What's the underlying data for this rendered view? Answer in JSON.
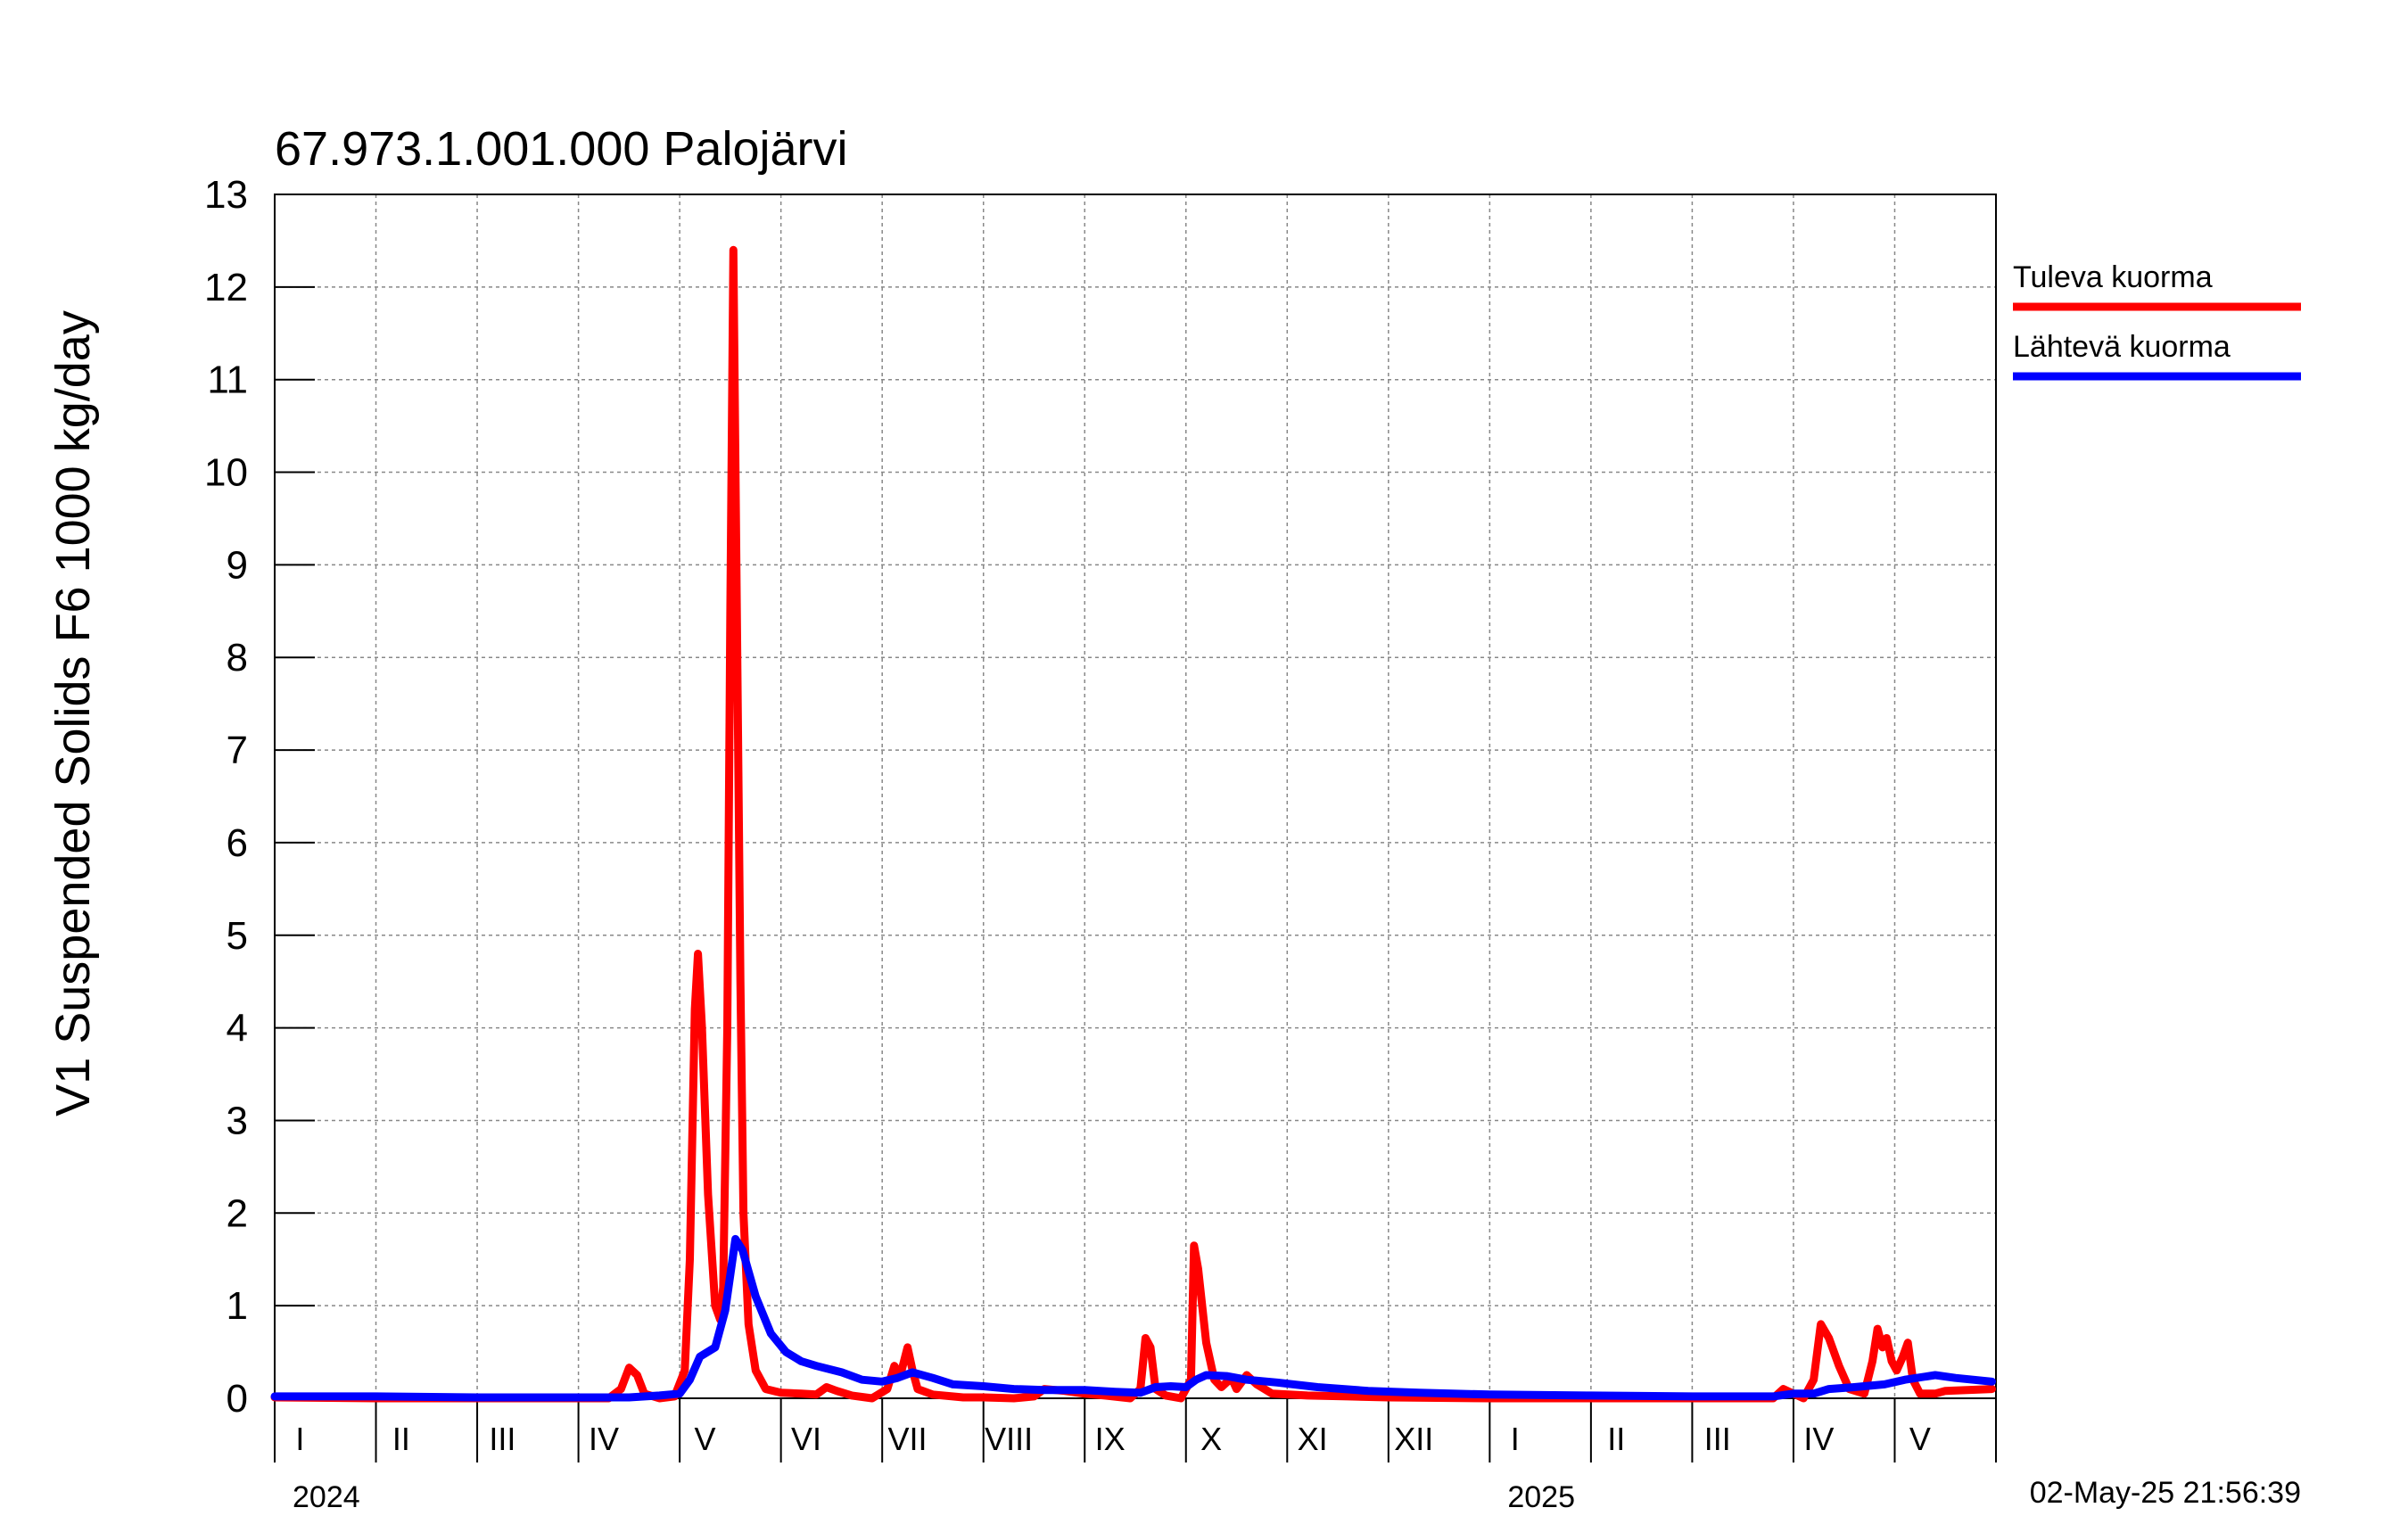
{
  "chart_data": {
    "type": "line",
    "title": "67.973.1.001.000 Palojärvi",
    "ylabel": "V1 Suspended Solids F6 1000 kg/day",
    "ylim": [
      0,
      13
    ],
    "yticks": [
      0,
      1,
      2,
      3,
      4,
      5,
      6,
      7,
      8,
      9,
      10,
      11,
      12,
      13
    ],
    "xlim": [
      0,
      17
    ],
    "months": [
      {
        "label": "I",
        "x": 0
      },
      {
        "label": "II",
        "x": 1
      },
      {
        "label": "III",
        "x": 2
      },
      {
        "label": "IV",
        "x": 3
      },
      {
        "label": "V",
        "x": 4
      },
      {
        "label": "VI",
        "x": 5
      },
      {
        "label": "VII",
        "x": 6
      },
      {
        "label": "VIII",
        "x": 7
      },
      {
        "label": "IX",
        "x": 8
      },
      {
        "label": "X",
        "x": 9
      },
      {
        "label": "XI",
        "x": 10
      },
      {
        "label": "XII",
        "x": 11
      },
      {
        "label": "I",
        "x": 12
      },
      {
        "label": "II",
        "x": 13
      },
      {
        "label": "III",
        "x": 14
      },
      {
        "label": "IV",
        "x": 15
      },
      {
        "label": "V",
        "x": 16
      }
    ],
    "years": [
      {
        "label": "2024",
        "x": 0
      },
      {
        "label": "2025",
        "x": 12
      }
    ],
    "grid": true,
    "legend_position": "right",
    "series": [
      {
        "name": "Tuleva kuorma",
        "color": "#ff0000",
        "points": [
          [
            0,
            0.01
          ],
          [
            1,
            0.0
          ],
          [
            2,
            0.0
          ],
          [
            3,
            0.0
          ],
          [
            3.3,
            0.0
          ],
          [
            3.42,
            0.1
          ],
          [
            3.5,
            0.33
          ],
          [
            3.58,
            0.25
          ],
          [
            3.65,
            0.05
          ],
          [
            3.8,
            0.0
          ],
          [
            3.95,
            0.02
          ],
          [
            4.05,
            0.3
          ],
          [
            4.1,
            1.5
          ],
          [
            4.15,
            4.2
          ],
          [
            4.18,
            4.8
          ],
          [
            4.22,
            4.0
          ],
          [
            4.28,
            2.2
          ],
          [
            4.35,
            1.0
          ],
          [
            4.4,
            0.85
          ],
          [
            4.43,
            1.2
          ],
          [
            4.47,
            4.0
          ],
          [
            4.5,
            8.5
          ],
          [
            4.53,
            12.4
          ],
          [
            4.56,
            9.0
          ],
          [
            4.6,
            4.5
          ],
          [
            4.63,
            2.0
          ],
          [
            4.68,
            0.8
          ],
          [
            4.75,
            0.3
          ],
          [
            4.85,
            0.1
          ],
          [
            5.0,
            0.06
          ],
          [
            5.2,
            0.05
          ],
          [
            5.35,
            0.04
          ],
          [
            5.45,
            0.12
          ],
          [
            5.55,
            0.08
          ],
          [
            5.7,
            0.03
          ],
          [
            5.9,
            0.0
          ],
          [
            6.05,
            0.1
          ],
          [
            6.12,
            0.35
          ],
          [
            6.18,
            0.25
          ],
          [
            6.25,
            0.55
          ],
          [
            6.3,
            0.3
          ],
          [
            6.35,
            0.1
          ],
          [
            6.5,
            0.04
          ],
          [
            6.8,
            0.01
          ],
          [
            7.0,
            0.01
          ],
          [
            7.3,
            0.0
          ],
          [
            7.5,
            0.02
          ],
          [
            7.6,
            0.1
          ],
          [
            7.8,
            0.08
          ],
          [
            8.0,
            0.05
          ],
          [
            8.2,
            0.03
          ],
          [
            8.45,
            0.0
          ],
          [
            8.55,
            0.1
          ],
          [
            8.6,
            0.65
          ],
          [
            8.65,
            0.55
          ],
          [
            8.7,
            0.1
          ],
          [
            8.8,
            0.03
          ],
          [
            8.95,
            0.0
          ],
          [
            9.05,
            0.2
          ],
          [
            9.08,
            1.65
          ],
          [
            9.12,
            1.4
          ],
          [
            9.2,
            0.6
          ],
          [
            9.28,
            0.2
          ],
          [
            9.35,
            0.12
          ],
          [
            9.45,
            0.22
          ],
          [
            9.5,
            0.1
          ],
          [
            9.6,
            0.25
          ],
          [
            9.7,
            0.15
          ],
          [
            9.85,
            0.05
          ],
          [
            10.2,
            0.03
          ],
          [
            10.6,
            0.02
          ],
          [
            11,
            0.01
          ],
          [
            12,
            0.0
          ],
          [
            13,
            0.0
          ],
          [
            14,
            0.0
          ],
          [
            14.8,
            0.0
          ],
          [
            14.9,
            0.1
          ],
          [
            15.0,
            0.05
          ],
          [
            15.1,
            0.0
          ],
          [
            15.2,
            0.2
          ],
          [
            15.27,
            0.8
          ],
          [
            15.35,
            0.65
          ],
          [
            15.45,
            0.35
          ],
          [
            15.55,
            0.1
          ],
          [
            15.7,
            0.05
          ],
          [
            15.78,
            0.4
          ],
          [
            15.83,
            0.75
          ],
          [
            15.88,
            0.55
          ],
          [
            15.92,
            0.65
          ],
          [
            15.97,
            0.4
          ],
          [
            16.02,
            0.3
          ],
          [
            16.08,
            0.45
          ],
          [
            16.13,
            0.6
          ],
          [
            16.18,
            0.2
          ],
          [
            16.25,
            0.05
          ],
          [
            16.4,
            0.05
          ],
          [
            16.5,
            0.08
          ],
          [
            16.96,
            0.1
          ]
        ]
      },
      {
        "name": "Lähtevä kuorma",
        "color": "#0000ff",
        "points": [
          [
            0,
            0.02
          ],
          [
            1,
            0.02
          ],
          [
            2,
            0.01
          ],
          [
            3,
            0.01
          ],
          [
            3.5,
            0.01
          ],
          [
            3.8,
            0.03
          ],
          [
            4.0,
            0.05
          ],
          [
            4.1,
            0.2
          ],
          [
            4.2,
            0.45
          ],
          [
            4.35,
            0.55
          ],
          [
            4.45,
            0.95
          ],
          [
            4.55,
            1.72
          ],
          [
            4.62,
            1.6
          ],
          [
            4.75,
            1.1
          ],
          [
            4.9,
            0.7
          ],
          [
            5.05,
            0.5
          ],
          [
            5.2,
            0.4
          ],
          [
            5.35,
            0.35
          ],
          [
            5.6,
            0.28
          ],
          [
            5.8,
            0.2
          ],
          [
            6.0,
            0.18
          ],
          [
            6.15,
            0.22
          ],
          [
            6.3,
            0.28
          ],
          [
            6.5,
            0.22
          ],
          [
            6.7,
            0.15
          ],
          [
            7.0,
            0.13
          ],
          [
            7.3,
            0.1
          ],
          [
            7.6,
            0.09
          ],
          [
            8.0,
            0.09
          ],
          [
            8.3,
            0.07
          ],
          [
            8.55,
            0.06
          ],
          [
            8.7,
            0.12
          ],
          [
            8.85,
            0.13
          ],
          [
            9.0,
            0.12
          ],
          [
            9.1,
            0.2
          ],
          [
            9.2,
            0.25
          ],
          [
            9.4,
            0.24
          ],
          [
            9.6,
            0.2
          ],
          [
            9.9,
            0.17
          ],
          [
            10.3,
            0.12
          ],
          [
            10.8,
            0.08
          ],
          [
            11.3,
            0.06
          ],
          [
            12,
            0.04
          ],
          [
            13,
            0.03
          ],
          [
            14,
            0.02
          ],
          [
            14.8,
            0.02
          ],
          [
            15.0,
            0.05
          ],
          [
            15.2,
            0.05
          ],
          [
            15.35,
            0.1
          ],
          [
            15.6,
            0.12
          ],
          [
            15.9,
            0.15
          ],
          [
            16.1,
            0.2
          ],
          [
            16.4,
            0.25
          ],
          [
            16.6,
            0.22
          ],
          [
            16.96,
            0.18
          ]
        ]
      }
    ]
  },
  "timestamp": "02-May-25 21:56:39"
}
